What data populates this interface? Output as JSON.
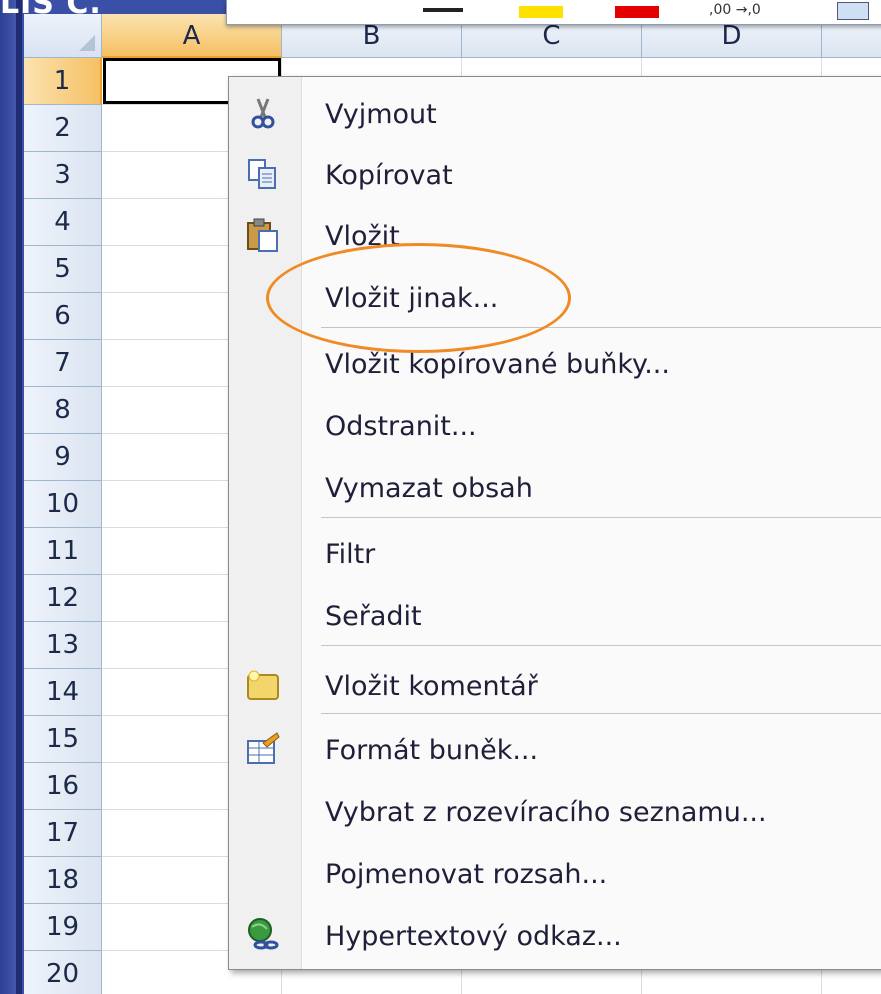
{
  "slide": {
    "title_fragment": "LIS C."
  },
  "sheet": {
    "columns": [
      "A",
      "B",
      "C",
      "D"
    ],
    "rows": [
      "1",
      "2",
      "3",
      "4",
      "5",
      "6",
      "7",
      "8",
      "9",
      "10",
      "11",
      "12",
      "13",
      "14",
      "15",
      "16",
      "17",
      "18",
      "19",
      "20"
    ]
  },
  "context_menu": {
    "items": [
      {
        "label": "Vyjmout",
        "icon": "scissors-icon"
      },
      {
        "label": "Kopírovat",
        "icon": "copy-icon"
      },
      {
        "label": "Vložit",
        "icon": "paste-icon"
      },
      {
        "label": "Vložit jinak...",
        "icon": ""
      },
      {
        "label": "Vložit kopírované buňky...",
        "icon": ""
      },
      {
        "label": "Odstranit...",
        "icon": ""
      },
      {
        "label": "Vymazat obsah",
        "icon": ""
      },
      {
        "label": "Filtr",
        "icon": "",
        "submenu": true
      },
      {
        "label": "Seřadit",
        "icon": "",
        "submenu": true
      },
      {
        "label": "Vložit komentář",
        "icon": "comment-icon"
      },
      {
        "label": "Formát buněk...",
        "icon": "format-cells-icon"
      },
      {
        "label": "Vybrat z rozevíracího seznamu...",
        "icon": ""
      },
      {
        "label": "Pojmenovat rozsah...",
        "icon": ""
      },
      {
        "label": "Hypertextový odkaz...",
        "icon": "hyperlink-icon"
      }
    ]
  },
  "highlight": {
    "target": "Vložit jinak...",
    "color": "#f08a24"
  }
}
